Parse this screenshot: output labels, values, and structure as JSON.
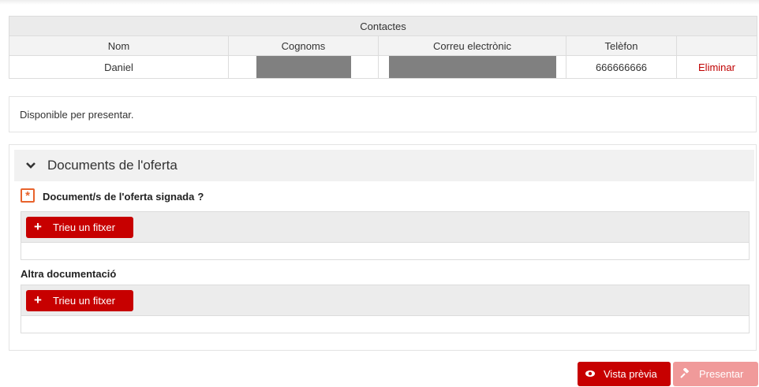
{
  "contacts": {
    "title": "Contactes",
    "headers": [
      "Nom",
      "Cognoms",
      "Correu electrònic",
      "Telèfon",
      ""
    ],
    "rows": [
      {
        "nom": "Daniel",
        "cognoms": "",
        "correu": "",
        "telefon": "666666666",
        "action": "Eliminar"
      }
    ]
  },
  "status": {
    "text": "Disponible per presentar."
  },
  "documents": {
    "section_title": "Documents de l'oferta",
    "required_label": "Document/s de l'oferta signada",
    "help_mark": "?",
    "upload_button": "Trieu un fitxer",
    "other_label": "Altra documentació"
  },
  "actions": {
    "preview": "Vista prèvia",
    "present": "Presentar"
  },
  "colors": {
    "primary_red": "#c70000",
    "disabled_red": "#f09a9a",
    "required_orange": "#e8632c",
    "delete_link": "#c00000"
  },
  "icons": [
    "chevron-down-icon",
    "asterisk-icon",
    "plus-icon",
    "eye-icon",
    "gavel-icon"
  ]
}
